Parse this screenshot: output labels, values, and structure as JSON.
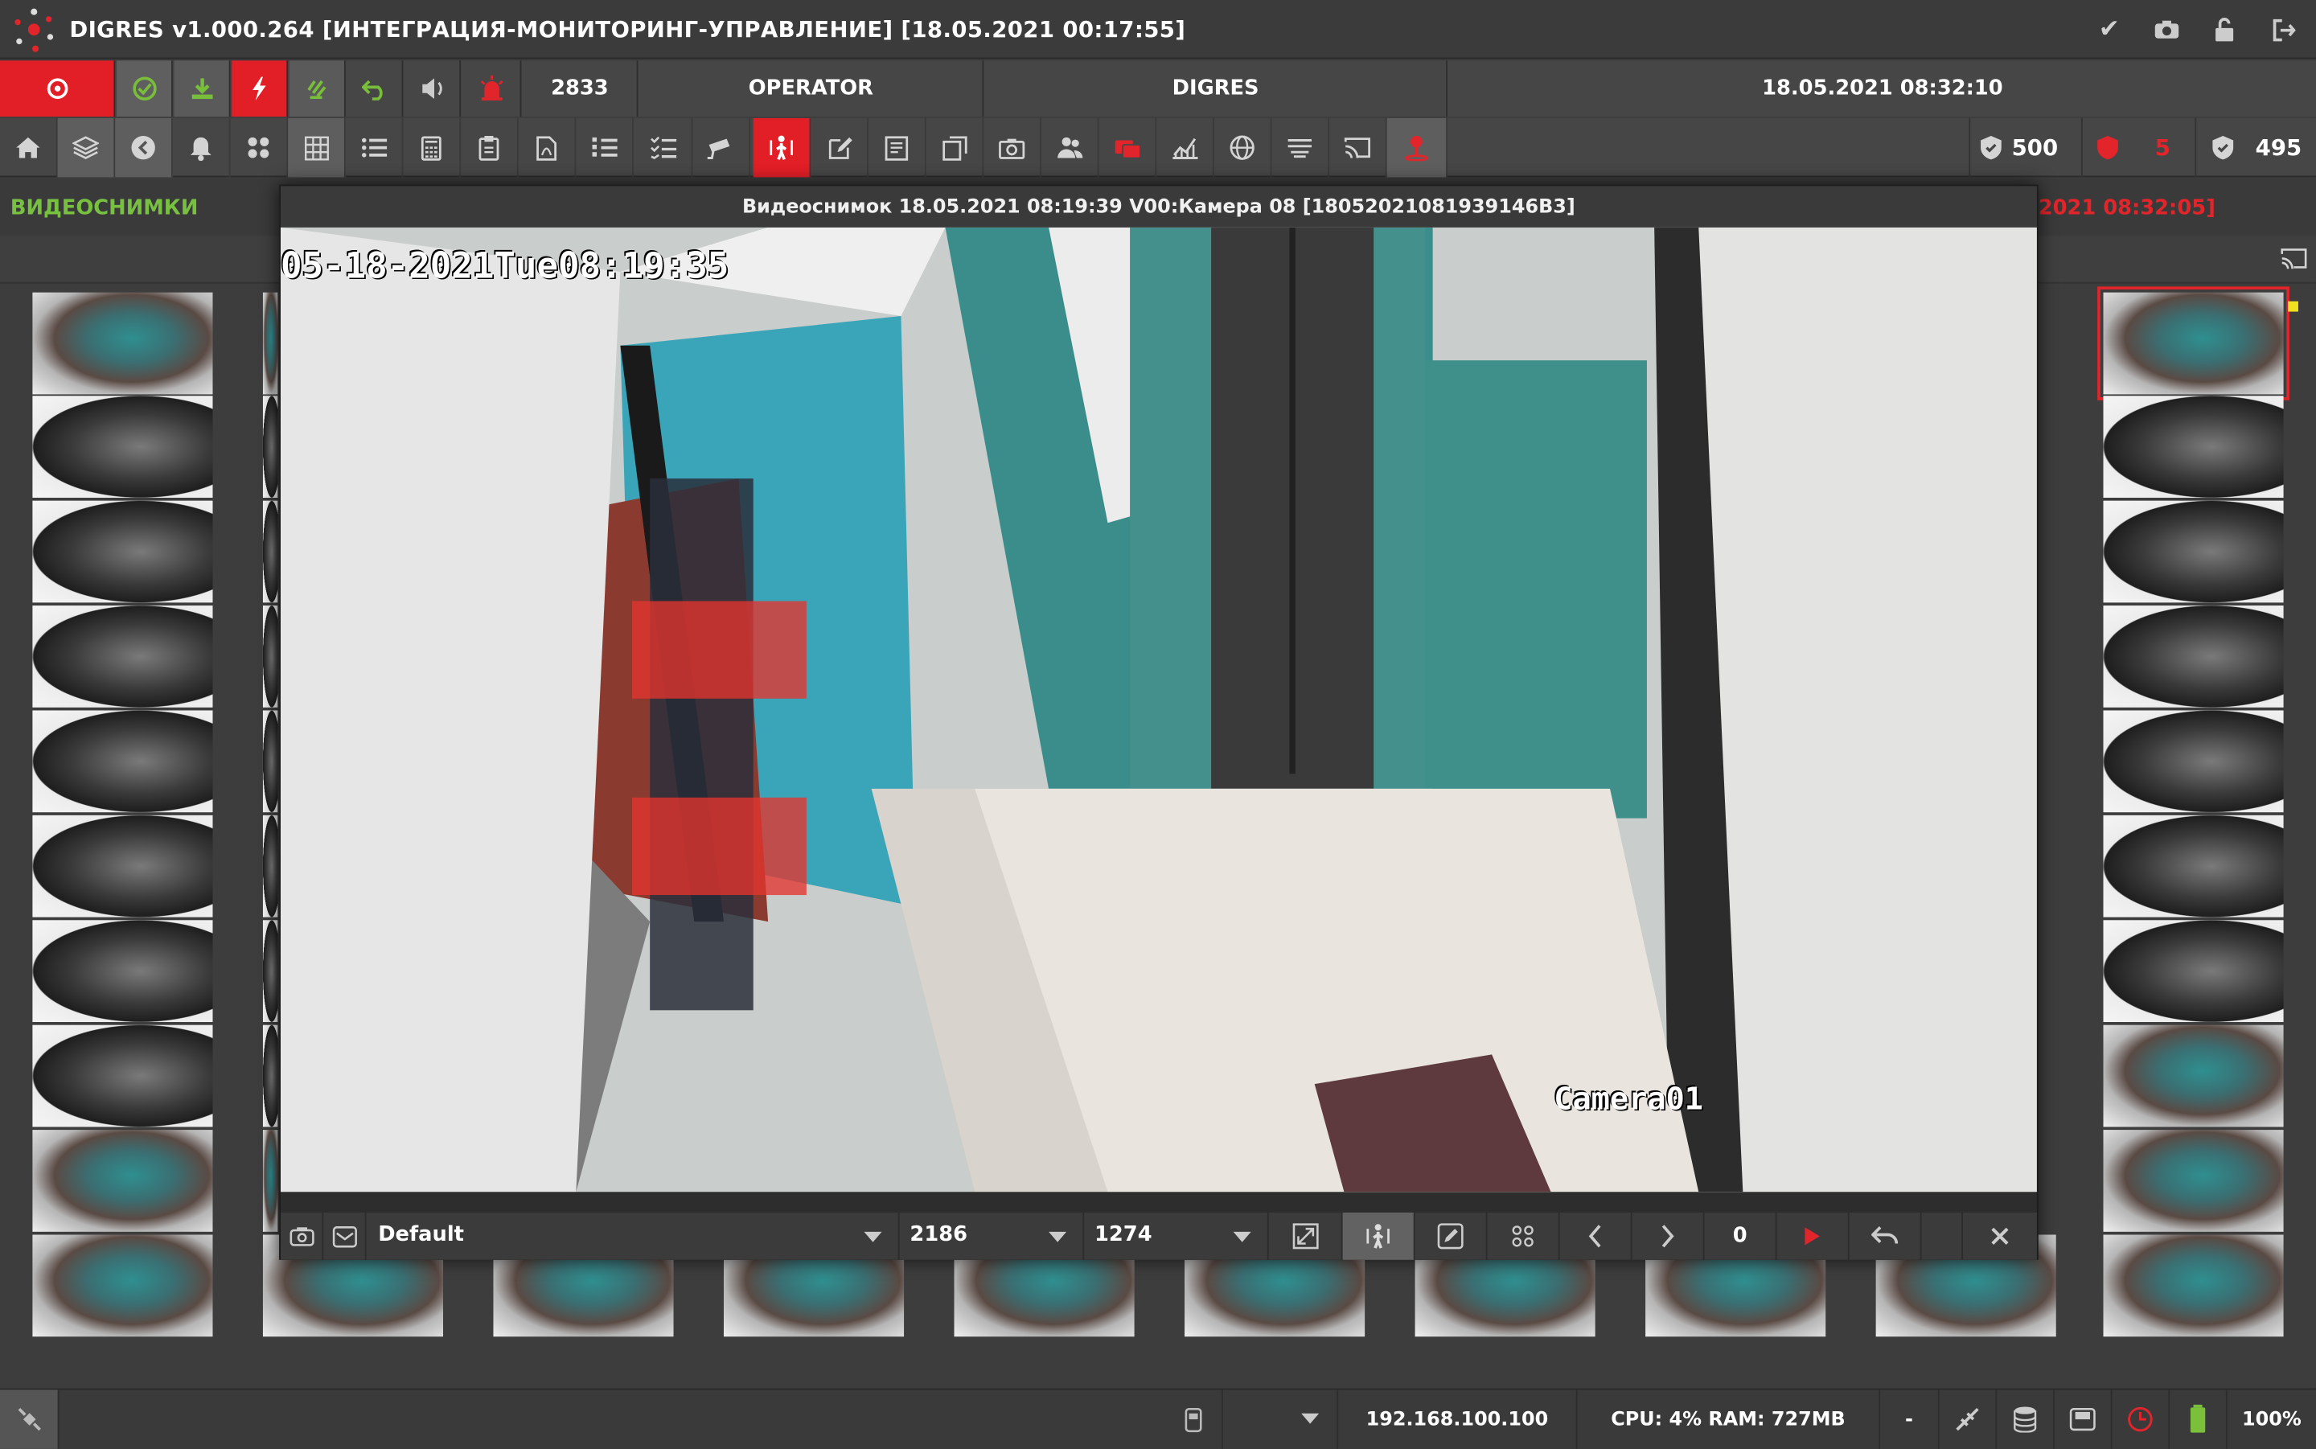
{
  "window": {
    "title": "DIGRES v1.000.264 [ИНТЕГРАЦИЯ-МОНИТОРИНГ-УПРАВЛЕНИЕ] [18.05.2021 00:17:55]"
  },
  "title_icons": [
    "check-circle-icon",
    "camera-icon",
    "lock-icon",
    "logout-icon"
  ],
  "row1": {
    "count": "2833",
    "role": "OPERATOR",
    "system": "DIGRES",
    "datetime": "18.05.2021 08:32:10"
  },
  "toolbar_icons": [
    "home-icon",
    "layers-icon",
    "back-circle-icon",
    "bell-icon",
    "dots-grid-icon",
    "grid-icon",
    "list-icon",
    "calculator-icon",
    "clipboard-icon",
    "pdf-icon",
    "numbered-list-icon",
    "checklist-icon",
    "camera-cctv-icon",
    "person-walk-icon",
    "edit-icon",
    "report-icon",
    "copy-icon",
    "photo-icon",
    "users-icon",
    "cards-icon",
    "chart-icon",
    "globe-icon",
    "lines-icon",
    "cast-icon",
    "pin-icon"
  ],
  "counters": {
    "ok": "500",
    "alarm": "5",
    "total": "495"
  },
  "section": {
    "title": "ВИДЕОСНИМКИ",
    "right_ts": "2021 08:32:05]"
  },
  "viewer": {
    "title": "Видеоснимок 18.05.2021 08:19:39 V00:Камера 08 [18052021081939146B3]",
    "osd_time": "05-18-2021Tue08:19:35",
    "osd_cam": "Camera01",
    "profile": "Default",
    "width": "2186",
    "height": "1274",
    "frame": "0"
  },
  "status": {
    "ip": "192.168.100.100",
    "perf": "CPU: 4% RAM: 727MB",
    "dash": "-",
    "zoom": "100%"
  },
  "colors": {
    "accent_red": "#e21e26",
    "green": "#7bbf3a",
    "bg_dark": "#3d3d3d",
    "section_green": "#77c040"
  }
}
